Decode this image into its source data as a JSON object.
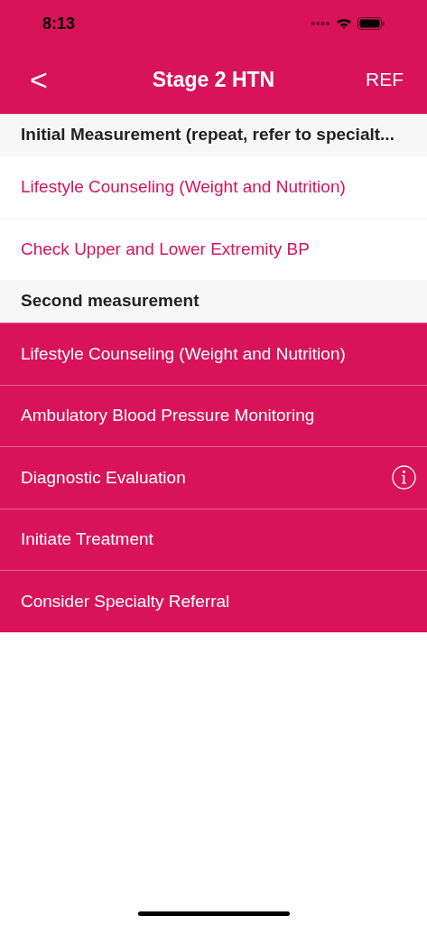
{
  "status_bar": {
    "time": "8:13"
  },
  "nav": {
    "back": "<",
    "title": "Stage 2 HTN",
    "action": "REF"
  },
  "sections": [
    {
      "header": "Initial Measurement (repeat, refer to specialt...",
      "rows": [
        {
          "label": "Lifestyle Counseling (Weight and Nutrition)",
          "highlighted": false,
          "info": false
        },
        {
          "label": "Check Upper and Lower Extremity BP",
          "highlighted": false,
          "info": false
        }
      ]
    },
    {
      "header": "Second measurement",
      "rows": [
        {
          "label": "Lifestyle Counseling (Weight and Nutrition)",
          "highlighted": true,
          "info": false
        },
        {
          "label": "Ambulatory Blood Pressure Monitoring",
          "highlighted": true,
          "info": false
        },
        {
          "label": "Diagnostic Evaluation",
          "highlighted": true,
          "info": true
        },
        {
          "label": "Initiate Treatment",
          "highlighted": true,
          "info": false
        },
        {
          "label": "Consider Specialty Referral",
          "highlighted": true,
          "info": false
        }
      ]
    }
  ]
}
